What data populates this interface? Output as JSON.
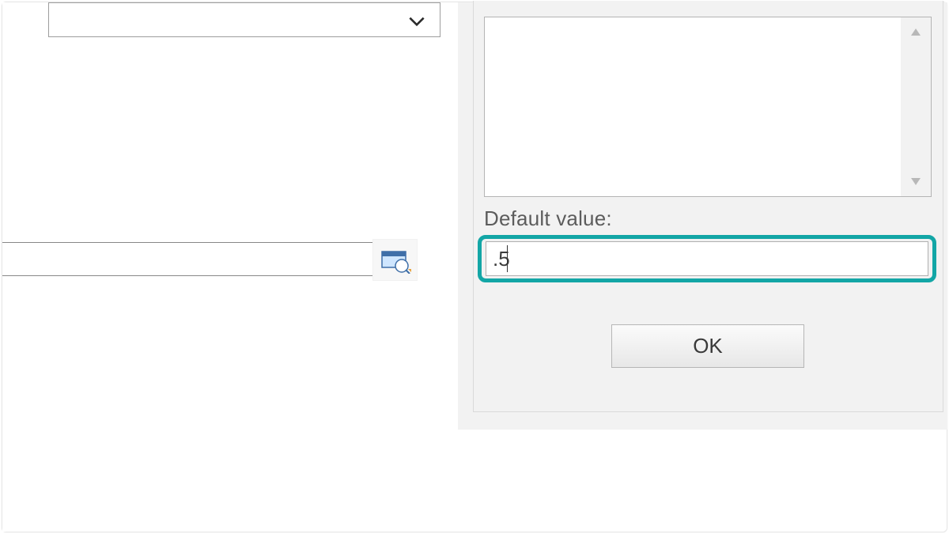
{
  "left": {
    "dropdown_value": "",
    "row_value": ""
  },
  "right": {
    "textarea_value": "",
    "default_value_label": "Default value:",
    "default_value_input": ".5",
    "ok_label": "OK"
  },
  "highlight_color": "#13a6a6"
}
